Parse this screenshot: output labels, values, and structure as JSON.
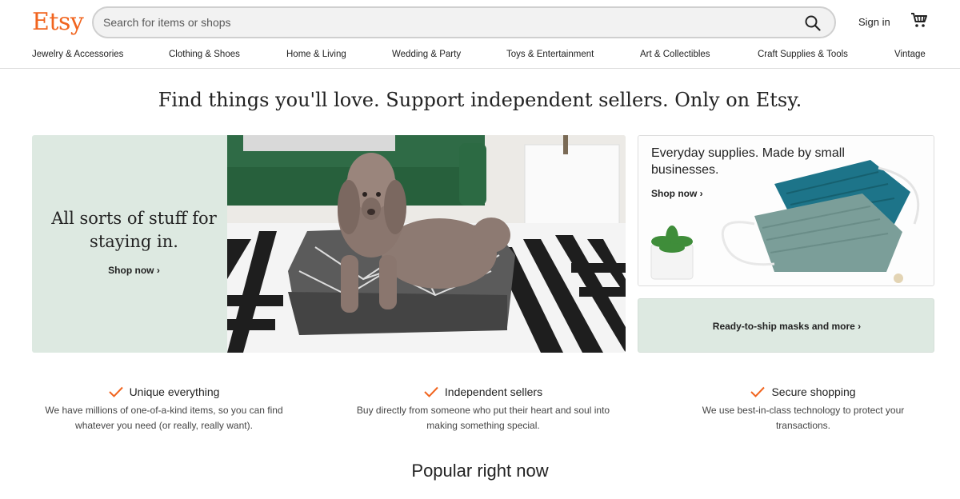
{
  "header": {
    "logo": "Etsy",
    "search_placeholder": "Search for items or shops",
    "search_value": "",
    "signin_label": "Sign in"
  },
  "categories": [
    "Jewelry & Accessories",
    "Clothing & Shoes",
    "Home & Living",
    "Wedding & Party",
    "Toys & Entertainment",
    "Art & Collectibles",
    "Craft Supplies & Tools",
    "Vintage"
  ],
  "tagline": "Find things you'll love. Support independent sellers. Only on Etsy.",
  "hero": {
    "title": "All sorts of stuff for staying in.",
    "shop_label": "Shop now ›"
  },
  "promo_supplies": {
    "title": "Everyday supplies. Made by small businesses.",
    "shop_label": "Shop now ›"
  },
  "promo_masks": {
    "label": "Ready-to-ship masks and more ›"
  },
  "value_props": [
    {
      "title": "Unique everything",
      "desc": "We have millions of one-of-a-kind items, so you can find whatever you need (or really, really want)."
    },
    {
      "title": "Independent sellers",
      "desc": "Buy directly from someone who put their heart and soul into making something special."
    },
    {
      "title": "Secure shopping",
      "desc": "We use best-in-class technology to protect your transactions."
    }
  ],
  "popular_heading": "Popular right now",
  "colors": {
    "brand": "#F1641E",
    "hero_bg": "#dde9e1",
    "check": "#F1641E"
  }
}
